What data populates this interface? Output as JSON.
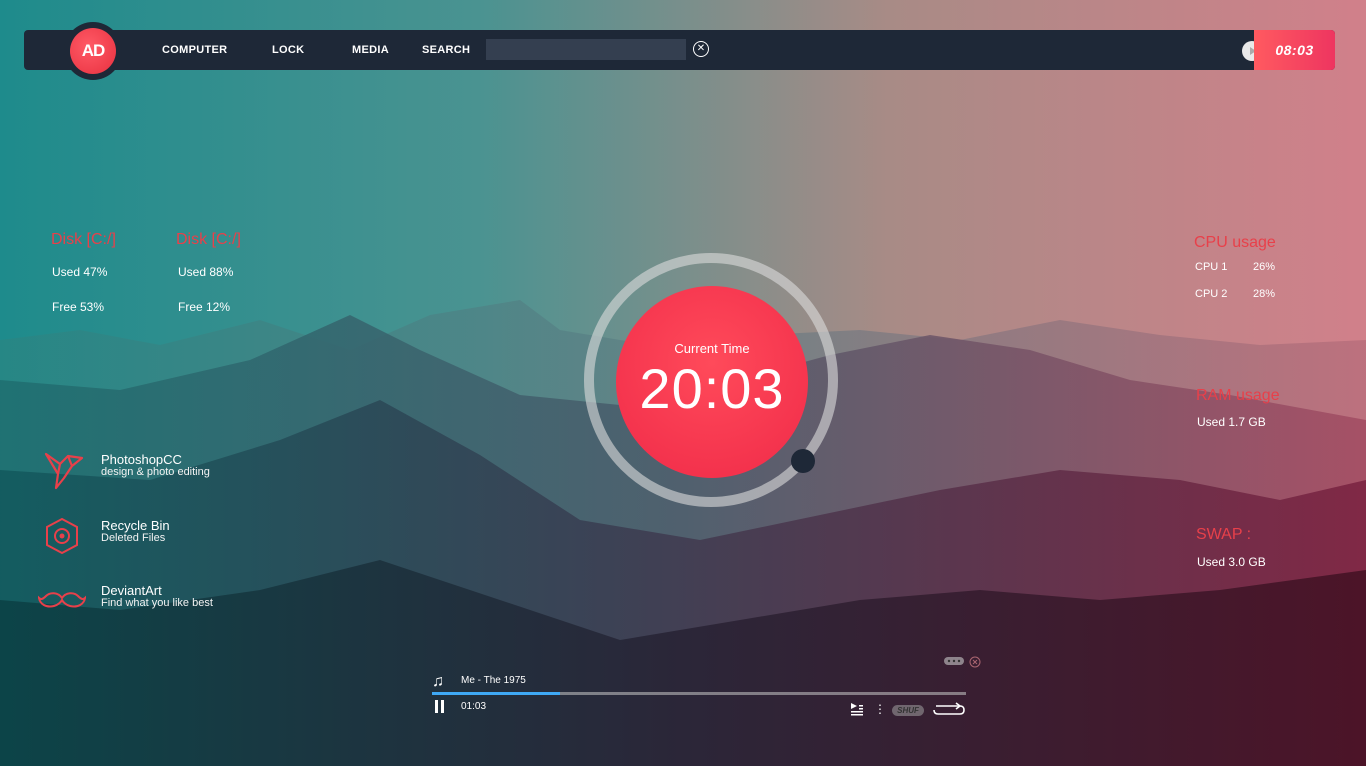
{
  "topbar": {
    "logo_text": "AD",
    "nav": [
      "COMPUTER",
      "LOCK",
      "MEDIA",
      "SEARCH"
    ],
    "search_placeholder": "",
    "clock": "08:03"
  },
  "disks": [
    {
      "title": "Disk [C:/]",
      "used": "Used 47%",
      "free": "Free 53%"
    },
    {
      "title": "Disk [C:/]",
      "used": "Used 88%",
      "free": "Free 12%"
    }
  ],
  "cpu": {
    "title": "CPU usage",
    "rows": [
      {
        "label": "CPU 1",
        "value": "26%"
      },
      {
        "label": "CPU 2",
        "value": "28%"
      }
    ]
  },
  "ram": {
    "title": "RAM usage",
    "used": "Used 1.7 GB"
  },
  "swap": {
    "title": "SWAP  :",
    "used": "Used 3.0 GB"
  },
  "clock": {
    "label": "Current Time",
    "time": "20:03"
  },
  "shortcuts": [
    {
      "title": "PhotoshopCC",
      "subtitle": "design & photo editing",
      "icon": "bird-icon"
    },
    {
      "title": "Recycle Bin",
      "subtitle": "Deleted Files",
      "icon": "recycle-bin-icon"
    },
    {
      "title": "DeviantArt",
      "subtitle": "Find what you like best",
      "icon": "mustache-icon"
    }
  ],
  "player": {
    "track": "Me - The 1975",
    "elapsed": "01:03",
    "progress": 0.24,
    "shuffle_label": "SHUF"
  },
  "colors": {
    "accent": "#e8404a",
    "bar": "#1e2837",
    "progress": "#3fa9f5"
  }
}
